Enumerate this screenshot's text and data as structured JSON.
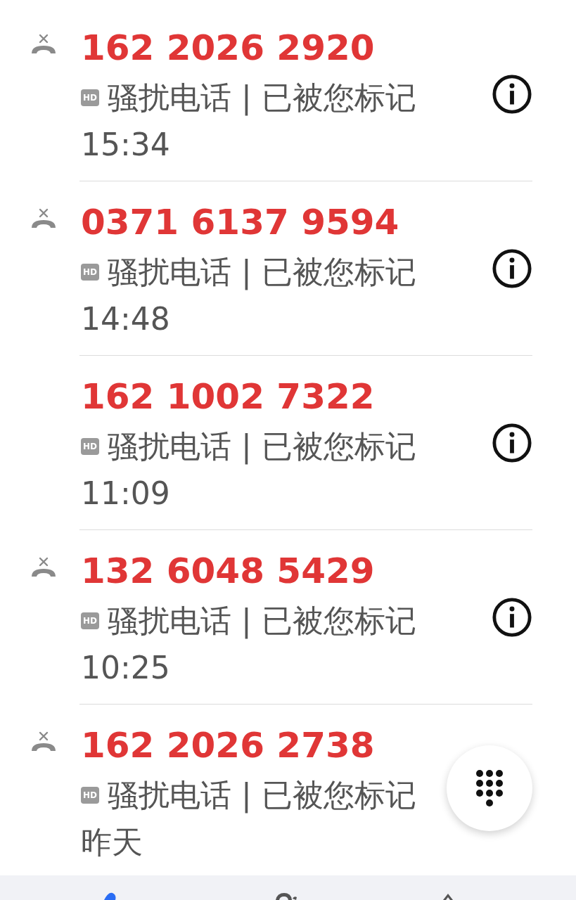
{
  "calls": [
    {
      "number": "162 2026 2920",
      "blocked": true,
      "badge": "HD",
      "label": "骚扰电话 | 已被您标记",
      "time": "15:34"
    },
    {
      "number": "0371 6137 9594",
      "blocked": true,
      "badge": "HD",
      "label": "骚扰电话 | 已被您标记",
      "time": "14:48"
    },
    {
      "number": "162 1002 7322",
      "blocked": false,
      "badge": "HD",
      "label": "骚扰电话 | 已被您标记",
      "time": "11:09"
    },
    {
      "number": "132 6048 5429",
      "blocked": true,
      "badge": "HD",
      "label": "骚扰电话 | 已被您标记",
      "time": "10:25"
    },
    {
      "number": "162 2026 2738",
      "blocked": true,
      "badge": "HD",
      "label": "骚扰电话 | 已被您标记",
      "time": "昨天"
    }
  ],
  "bottom_nav": {
    "tabs": [
      {
        "selected": true
      },
      {
        "selected": false
      },
      {
        "selected": false
      }
    ]
  }
}
